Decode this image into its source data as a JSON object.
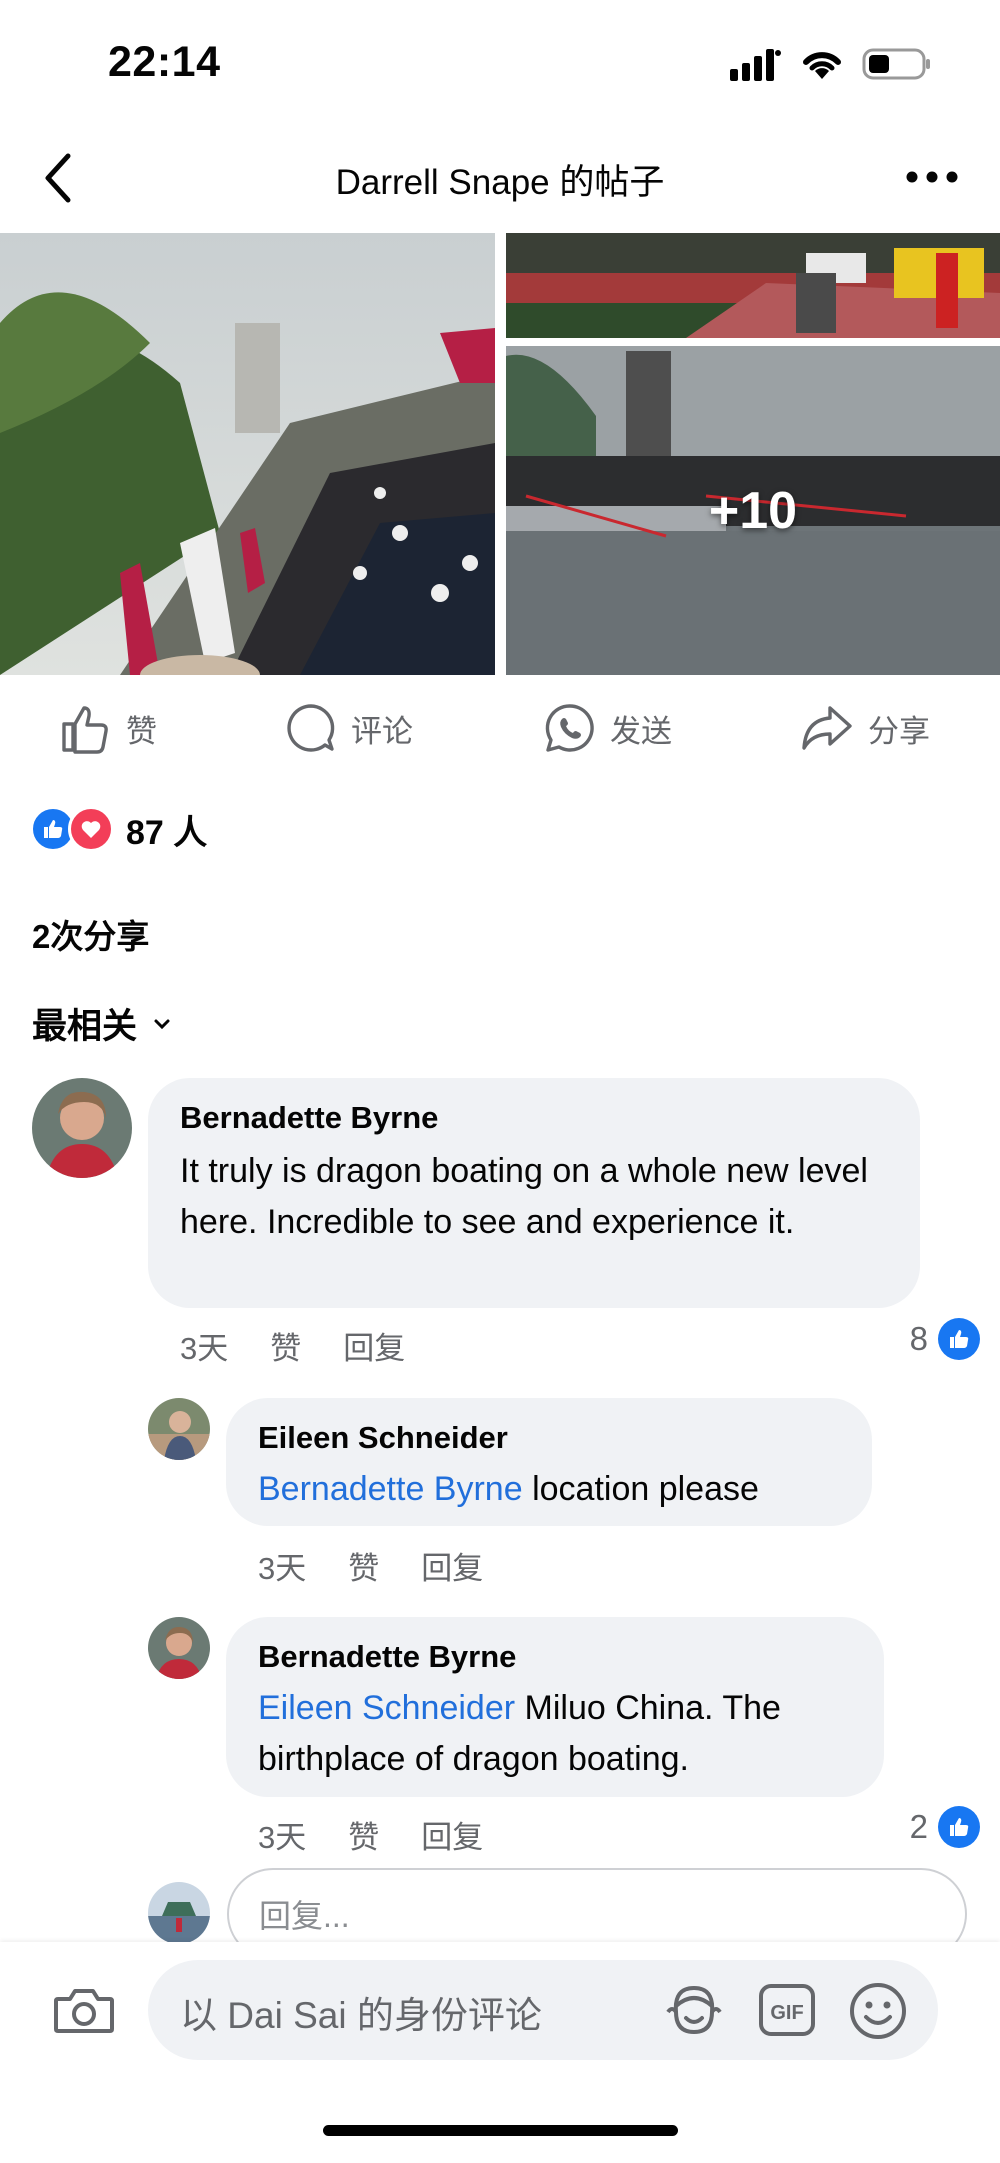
{
  "status_bar": {
    "time": "22:14"
  },
  "header": {
    "title": "Darrell Snape 的帖子"
  },
  "photos": {
    "more_count": "+10"
  },
  "actions": {
    "like": "赞",
    "comment": "评论",
    "send": "发送",
    "share": "分享"
  },
  "reactions": {
    "count": "87 人"
  },
  "shares": {
    "label": "2次分享"
  },
  "sort": {
    "label": "最相关"
  },
  "comments": [
    {
      "author": "Bernadette Byrne",
      "mention": "",
      "text": "It truly is dragon boating on a whole new level here. Incredible to see and experience it.",
      "time": "3天",
      "like": "赞",
      "reply": "回复",
      "likes": "8"
    },
    {
      "author": "Eileen Schneider",
      "mention": "Bernadette Byrne",
      "text": " location please",
      "time": "3天",
      "like": "赞",
      "reply": "回复",
      "likes": ""
    },
    {
      "author": "Bernadette Byrne",
      "mention": "Eileen Schneider",
      "text": " Miluo China. The birthplace of dragon boating.",
      "time": "3天",
      "like": "赞",
      "reply": "回复",
      "likes": "2"
    }
  ],
  "reply_box": {
    "placeholder": "回复..."
  },
  "composer": {
    "placeholder": "以 Dai Sai 的身份评论"
  },
  "colors": {
    "accent": "#1877f2",
    "mention": "#216fdb",
    "bubble": "#f0f2f5",
    "love": "#f33e58"
  },
  "icons": [
    "chevron-left-icon",
    "more-icon",
    "thumbs-up-icon",
    "comment-icon",
    "whatsapp-icon",
    "share-icon",
    "like-reaction-icon",
    "love-reaction-icon",
    "chevron-down-icon",
    "camera-icon",
    "avatar-sticker-icon",
    "gif-icon",
    "emoji-icon"
  ]
}
